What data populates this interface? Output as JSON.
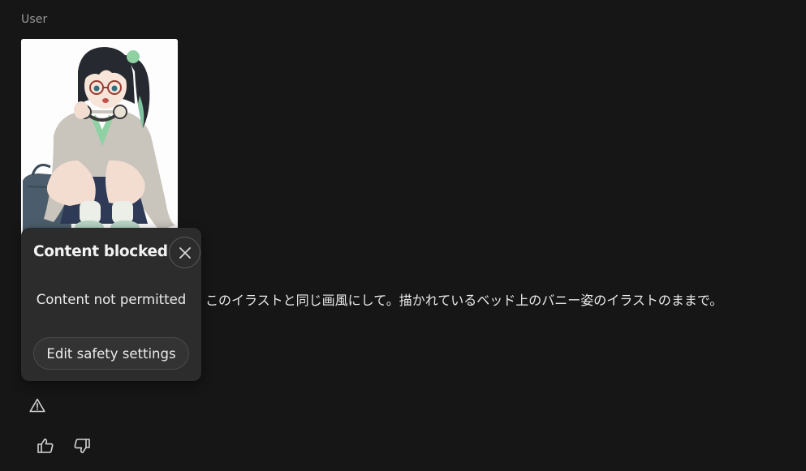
{
  "message": {
    "role_label": "User",
    "image_alt": "Illustration of a girl with glasses and headphones sitting beside a school bag",
    "prompt_text": "このイラストと同じ画風にして。描かれているベッド上のバニー姿のイラストのままで。"
  },
  "blocked_popup": {
    "title": "Content blocked",
    "message": "Content not permitted",
    "action_label": "Edit safety settings",
    "close_icon": "close-icon"
  },
  "actions": {
    "warning_icon": "warning-icon",
    "like_icon": "thumbs-up-icon",
    "dislike_icon": "thumbs-down-icon"
  },
  "colors": {
    "background": "#161616",
    "popup_bg": "#2c2c2c",
    "text": "#e6e6e6",
    "muted": "#9a9a9a"
  }
}
